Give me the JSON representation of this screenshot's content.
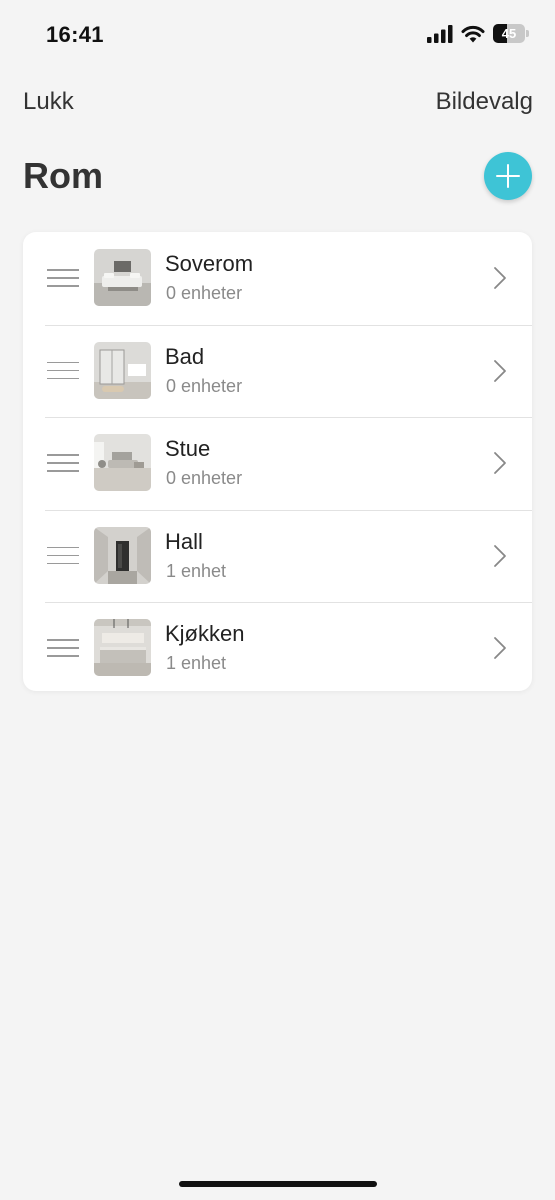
{
  "status_bar": {
    "time": "16:41",
    "battery_level": "45",
    "battery_fraction": 0.45,
    "icons": [
      "cellular-signal-icon",
      "wifi-icon",
      "battery-icon"
    ]
  },
  "nav": {
    "left_label": "Lukk",
    "right_label": "Bildevalg"
  },
  "page": {
    "title": "Rom",
    "add_icon": "plus-icon"
  },
  "colors": {
    "accent": "#3ec4d6",
    "background": "#f4f4f4",
    "card": "#ffffff",
    "secondary_text": "#8a8a8a"
  },
  "rooms": [
    {
      "name": "Soverom",
      "count": "0 enheter",
      "thumb": "bedroom-photo"
    },
    {
      "name": "Bad",
      "count": "0 enheter",
      "thumb": "bathroom-photo"
    },
    {
      "name": "Stue",
      "count": "0 enheter",
      "thumb": "living-room-photo"
    },
    {
      "name": "Hall",
      "count": "1 enhet",
      "thumb": "hallway-photo"
    },
    {
      "name": "Kjøkken",
      "count": "1 enhet",
      "thumb": "kitchen-photo"
    }
  ]
}
